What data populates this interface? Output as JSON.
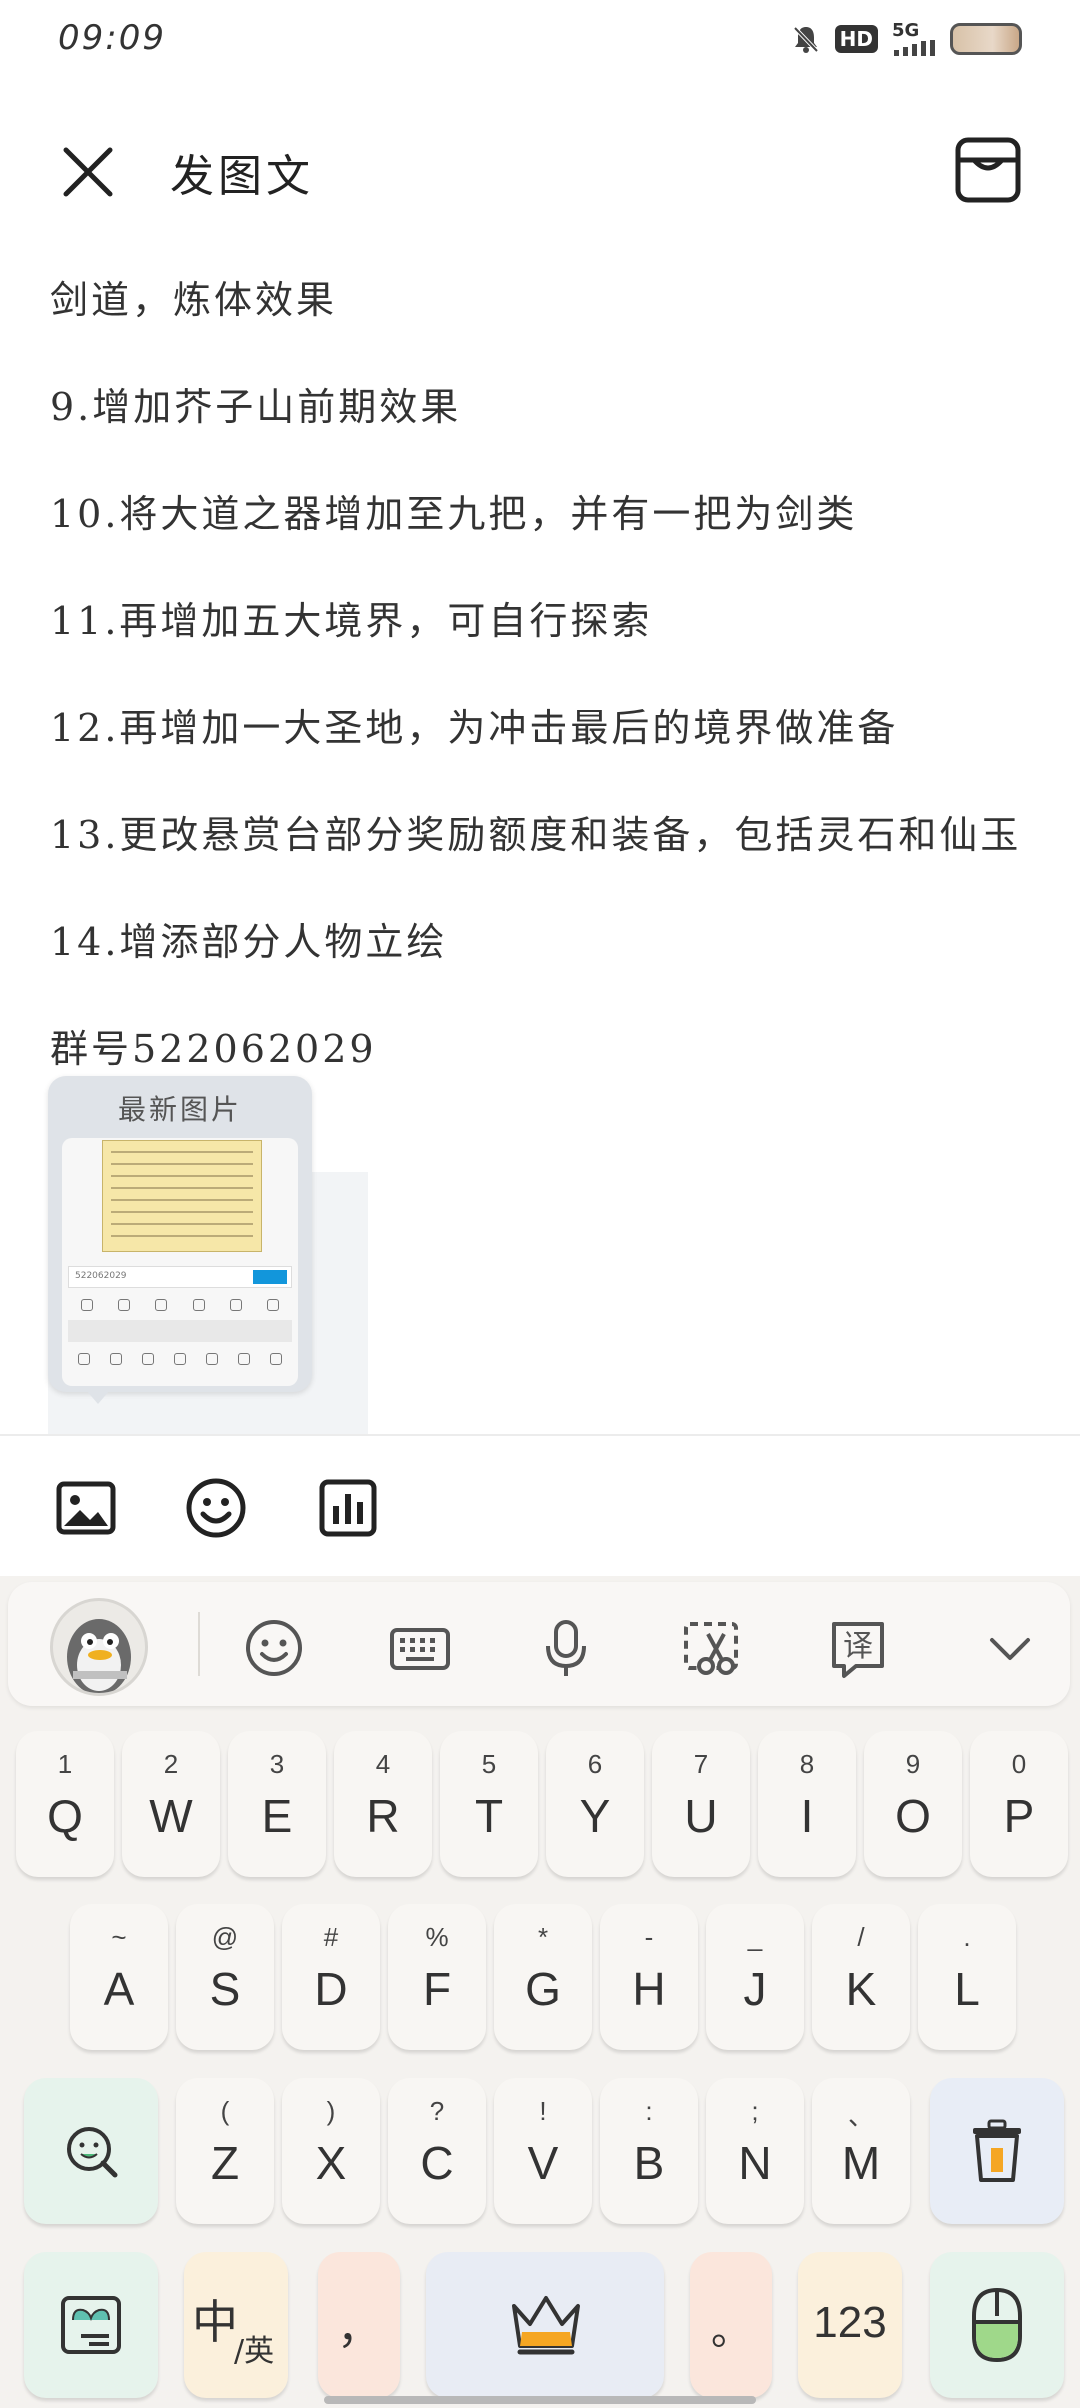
{
  "status": {
    "time": "09:09",
    "hd": "HD",
    "network": "5G"
  },
  "header": {
    "title": "发图文"
  },
  "content": {
    "lines": [
      "剑道，炼体效果",
      "9.增加芥子山前期效果",
      "10.将大道之器增加至九把，并有一把为剑类",
      "11.再增加五大境界，可自行探索",
      "12.再增加一大圣地，为冲击最后的境界做准备",
      "13.更改悬赏台部分奖励额度和装备，包括灵石和仙玉",
      "14.增添部分人物立绘",
      "群号522062029"
    ]
  },
  "latest_image": {
    "label": "最新图片",
    "thumb_text": "522062029"
  },
  "toolbar": {
    "icons": [
      "image-icon",
      "emoji-icon",
      "chart-icon"
    ]
  },
  "keyboard": {
    "top_icons": [
      "qq-avatar",
      "emoji-icon",
      "keyboard-icon",
      "microphone-icon",
      "scissors-icon",
      "translate-icon",
      "chevron-down-icon"
    ],
    "row1": [
      {
        "sub": "1",
        "main": "Q"
      },
      {
        "sub": "2",
        "main": "W"
      },
      {
        "sub": "3",
        "main": "E"
      },
      {
        "sub": "4",
        "main": "R"
      },
      {
        "sub": "5",
        "main": "T"
      },
      {
        "sub": "6",
        "main": "Y"
      },
      {
        "sub": "7",
        "main": "U"
      },
      {
        "sub": "8",
        "main": "I"
      },
      {
        "sub": "9",
        "main": "O"
      },
      {
        "sub": "0",
        "main": "P"
      }
    ],
    "row2": [
      {
        "sub": "~",
        "main": "A"
      },
      {
        "sub": "@",
        "main": "S"
      },
      {
        "sub": "#",
        "main": "D"
      },
      {
        "sub": "%",
        "main": "F"
      },
      {
        "sub": "*",
        "main": "G"
      },
      {
        "sub": "-",
        "main": "H"
      },
      {
        "sub": "_",
        "main": "J"
      },
      {
        "sub": "/",
        "main": "K"
      },
      {
        "sub": ".",
        "main": "L"
      }
    ],
    "row3": [
      {
        "sub": "(",
        "main": "Z"
      },
      {
        "sub": ")",
        "main": "X"
      },
      {
        "sub": "?",
        "main": "C"
      },
      {
        "sub": "!",
        "main": "V"
      },
      {
        "sub": ":",
        "main": "B"
      },
      {
        "sub": ";",
        "main": "N"
      },
      {
        "sub": "、",
        "main": "M"
      }
    ],
    "lang_main": "中",
    "lang_sub": "/英",
    "comma": "，",
    "period": "。",
    "num": "123",
    "colors": {
      "search": "#e6f3ec",
      "delete": "#e8edf6",
      "lang": "#fbf0dc",
      "comma": "#fbe6dc",
      "space": "#e8ecf4",
      "period": "#fbe6dc",
      "num": "#fbf0dc",
      "emoji": "#e6f3ec"
    }
  }
}
